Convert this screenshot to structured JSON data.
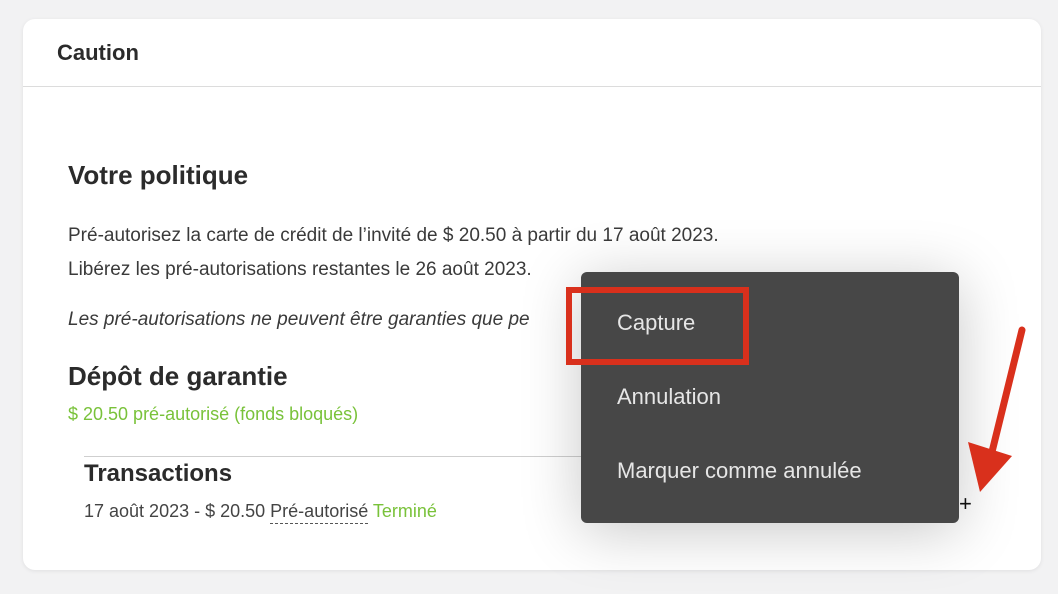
{
  "card": {
    "title": "Caution"
  },
  "policy": {
    "title": "Votre politique",
    "line1": "Pré-autorisez la carte de crédit de l’invité de $ 20.50 à partir du 17 août 2023.",
    "line2": "Libérez les pré-autorisations restantes le 26 août 2023.",
    "note": "Les pré-autorisations ne peuvent être garanties que pe"
  },
  "deposit": {
    "title": "Dépôt de garantie",
    "status": "$ 20.50 pré-autorisé (fonds bloqués)"
  },
  "transactions": {
    "title": "Transactions",
    "rows": [
      {
        "summary": "17 août 2023 - $ 20.50",
        "status": "Pré-autorisé",
        "state": "Terminé"
      }
    ],
    "add_symbol": "+"
  },
  "menu": {
    "items": [
      {
        "label": "Capture"
      },
      {
        "label": "Annulation"
      },
      {
        "label": "Marquer comme annulée"
      }
    ]
  },
  "colors": {
    "accent_green": "#79c23a",
    "menu_bg": "#474747",
    "annotation_red": "#d9301c"
  },
  "icons": {
    "add": "plus-icon",
    "annotation_arrow": "arrow-icon"
  }
}
